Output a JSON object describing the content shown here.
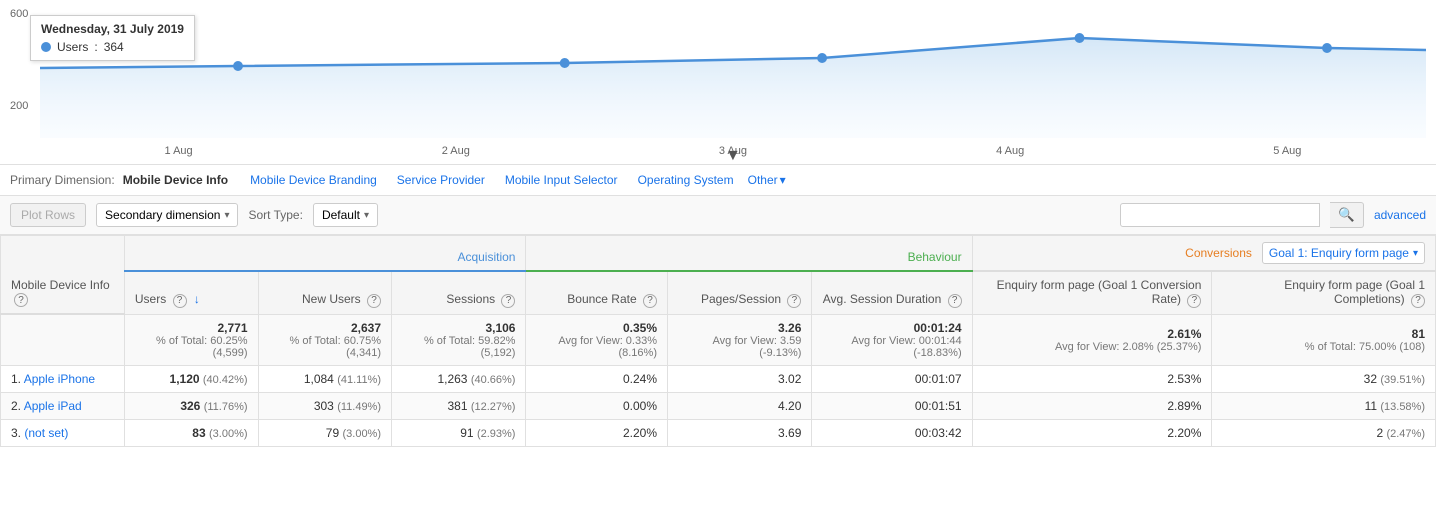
{
  "chart": {
    "y_labels": [
      "600",
      "200"
    ],
    "x_labels": [
      "1 Aug",
      "2 Aug",
      "3 Aug",
      "4 Aug",
      "5 Aug"
    ],
    "tooltip": {
      "title": "Wednesday, 31 July 2019",
      "metric": "Users",
      "value": "364"
    }
  },
  "primary_dimension": {
    "label": "Primary Dimension:",
    "value": "Mobile Device Info",
    "links": [
      "Mobile Device Branding",
      "Service Provider",
      "Mobile Input Selector",
      "Operating System"
    ],
    "other": "Other"
  },
  "toolbar": {
    "plot_rows": "Plot Rows",
    "secondary_dim": "Secondary dimension",
    "sort_label": "Sort Type:",
    "sort_default": "Default",
    "advanced": "advanced"
  },
  "table": {
    "row_header": "Mobile Device Info",
    "acquisition_label": "Acquisition",
    "behaviour_label": "Behaviour",
    "conversions_label": "Conversions",
    "goal_label": "Goal 1: Enquiry form page",
    "columns": {
      "users": "Users",
      "new_users": "New Users",
      "sessions": "Sessions",
      "bounce_rate": "Bounce Rate",
      "pages_session": "Pages/Session",
      "avg_session": "Avg. Session Duration",
      "enquiry_rate": "Enquiry form page (Goal 1 Conversion Rate)",
      "enquiry_completions": "Enquiry form page (Goal 1 Completions)"
    },
    "totals": {
      "users": "2,771",
      "users_pct": "% of Total: 60.25% (4,599)",
      "new_users": "2,637",
      "new_users_pct": "% of Total: 60.75% (4,341)",
      "sessions": "3,106",
      "sessions_pct": "% of Total: 59.82% (5,192)",
      "bounce_rate": "0.35%",
      "bounce_rate_sub": "Avg for View: 0.33% (8.16%)",
      "pages_session": "3.26",
      "pages_session_sub": "Avg for View: 3.59 (-9.13%)",
      "avg_session": "00:01:24",
      "avg_session_sub": "Avg for View: 00:01:44 (-18.83%)",
      "enquiry_rate": "2.61%",
      "enquiry_rate_sub": "Avg for View: 2.08% (25.37%)",
      "enquiry_completions": "81",
      "enquiry_completions_pct": "% of Total: 75.00% (108)"
    },
    "rows": [
      {
        "rank": "1.",
        "name": "Apple iPhone",
        "users": "1,120",
        "users_pct": "(40.42%)",
        "new_users": "1,084",
        "new_users_pct": "(41.11%)",
        "sessions": "1,263",
        "sessions_pct": "(40.66%)",
        "bounce_rate": "0.24%",
        "pages_session": "3.02",
        "avg_session": "00:01:07",
        "enquiry_rate": "2.53%",
        "enquiry_completions": "32",
        "enquiry_completions_pct": "(39.51%)"
      },
      {
        "rank": "2.",
        "name": "Apple iPad",
        "users": "326",
        "users_pct": "(11.76%)",
        "new_users": "303",
        "new_users_pct": "(11.49%)",
        "sessions": "381",
        "sessions_pct": "(12.27%)",
        "bounce_rate": "0.00%",
        "pages_session": "4.20",
        "avg_session": "00:01:51",
        "enquiry_rate": "2.89%",
        "enquiry_completions": "11",
        "enquiry_completions_pct": "(13.58%)"
      },
      {
        "rank": "3.",
        "name": "(not set)",
        "users": "83",
        "users_pct": "(3.00%)",
        "new_users": "79",
        "new_users_pct": "(3.00%)",
        "sessions": "91",
        "sessions_pct": "(2.93%)",
        "bounce_rate": "2.20%",
        "pages_session": "3.69",
        "avg_session": "00:03:42",
        "enquiry_rate": "2.20%",
        "enquiry_completions": "2",
        "enquiry_completions_pct": "(2.47%)"
      }
    ]
  }
}
